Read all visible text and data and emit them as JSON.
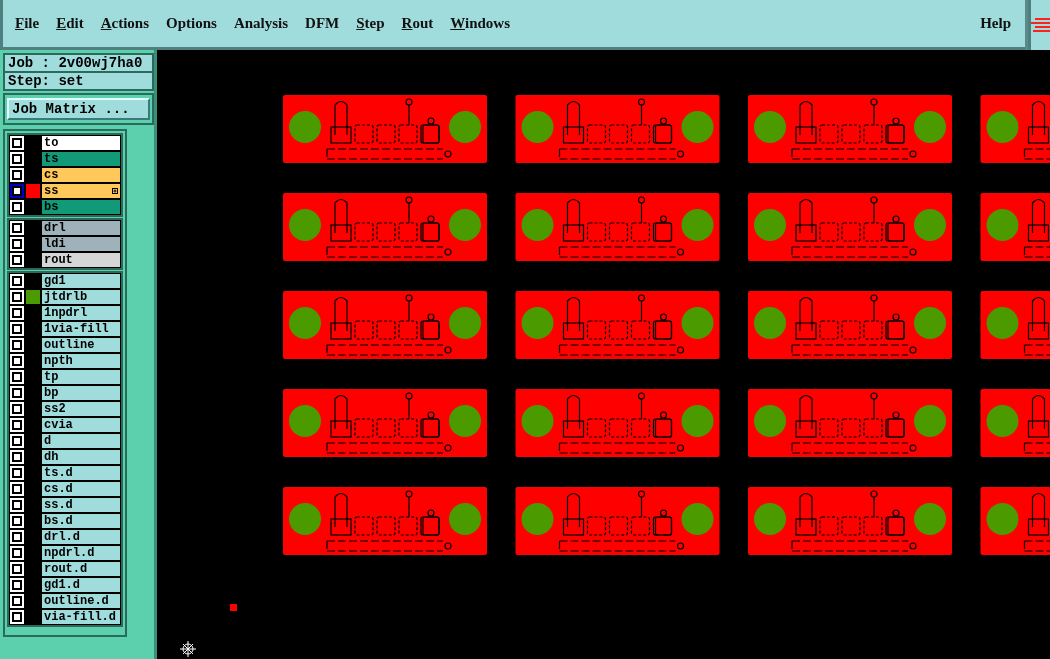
{
  "menu": [
    {
      "label": "File",
      "mnemonic": true
    },
    {
      "label": "Edit",
      "mnemonic": true
    },
    {
      "label": "Actions",
      "mnemonic": true
    },
    {
      "label": "Options",
      "mnemonic": false
    },
    {
      "label": "Analysis",
      "mnemonic": false
    },
    {
      "label": "DFM",
      "mnemonic": false
    },
    {
      "label": "Step",
      "mnemonic": true
    },
    {
      "label": "Rout",
      "mnemonic": true
    },
    {
      "label": "Windows",
      "mnemonic": true
    }
  ],
  "help": "Help",
  "job": "Job : 2v00wj7ha0",
  "step": "Step: set",
  "matrix_button": "Job Matrix ...",
  "layer_groups": [
    [
      {
        "name": "to",
        "kind": "top",
        "active": false
      },
      {
        "name": "ts",
        "kind": "mask",
        "active": false
      },
      {
        "name": "cs",
        "kind": "silk",
        "active": false
      },
      {
        "name": "ss",
        "kind": "silk",
        "active": true,
        "color": "#ff0000"
      },
      {
        "name": "bs",
        "kind": "mask",
        "active": false
      }
    ],
    [
      {
        "name": "drl",
        "kind": "drill",
        "active": false
      },
      {
        "name": "ldi",
        "kind": "drill",
        "active": false
      },
      {
        "name": "rout",
        "kind": "rout",
        "active": false
      }
    ],
    [
      {
        "name": "gd1",
        "kind": "misc",
        "active": false
      },
      {
        "name": "jtdrlb",
        "kind": "misc",
        "active": false,
        "color": "#4a9a00"
      },
      {
        "name": "1npdrl",
        "kind": "misc",
        "active": false
      },
      {
        "name": "1via-fill",
        "kind": "misc",
        "active": false
      },
      {
        "name": "outline",
        "kind": "misc",
        "active": false
      },
      {
        "name": "npth",
        "kind": "misc",
        "active": false
      },
      {
        "name": "tp",
        "kind": "misc",
        "active": false
      },
      {
        "name": "bp",
        "kind": "misc",
        "active": false
      },
      {
        "name": "ss2",
        "kind": "misc",
        "active": false
      },
      {
        "name": "cvia",
        "kind": "misc",
        "active": false
      },
      {
        "name": "d",
        "kind": "misc",
        "active": false
      },
      {
        "name": "dh",
        "kind": "misc",
        "active": false
      },
      {
        "name": "ts.d",
        "kind": "misc",
        "active": false
      },
      {
        "name": "cs.d",
        "kind": "misc",
        "active": false
      },
      {
        "name": "ss.d",
        "kind": "misc",
        "active": false
      },
      {
        "name": "bs.d",
        "kind": "misc",
        "active": false
      },
      {
        "name": "drl.d",
        "kind": "misc",
        "active": false
      },
      {
        "name": "npdrl.d",
        "kind": "misc",
        "active": false
      },
      {
        "name": "rout.d",
        "kind": "misc",
        "active": false
      },
      {
        "name": "gd1.d",
        "kind": "misc",
        "active": false
      },
      {
        "name": "outline.d",
        "kind": "misc",
        "active": false
      },
      {
        "name": "via-fill.d",
        "kind": "misc",
        "active": false
      }
    ]
  ]
}
